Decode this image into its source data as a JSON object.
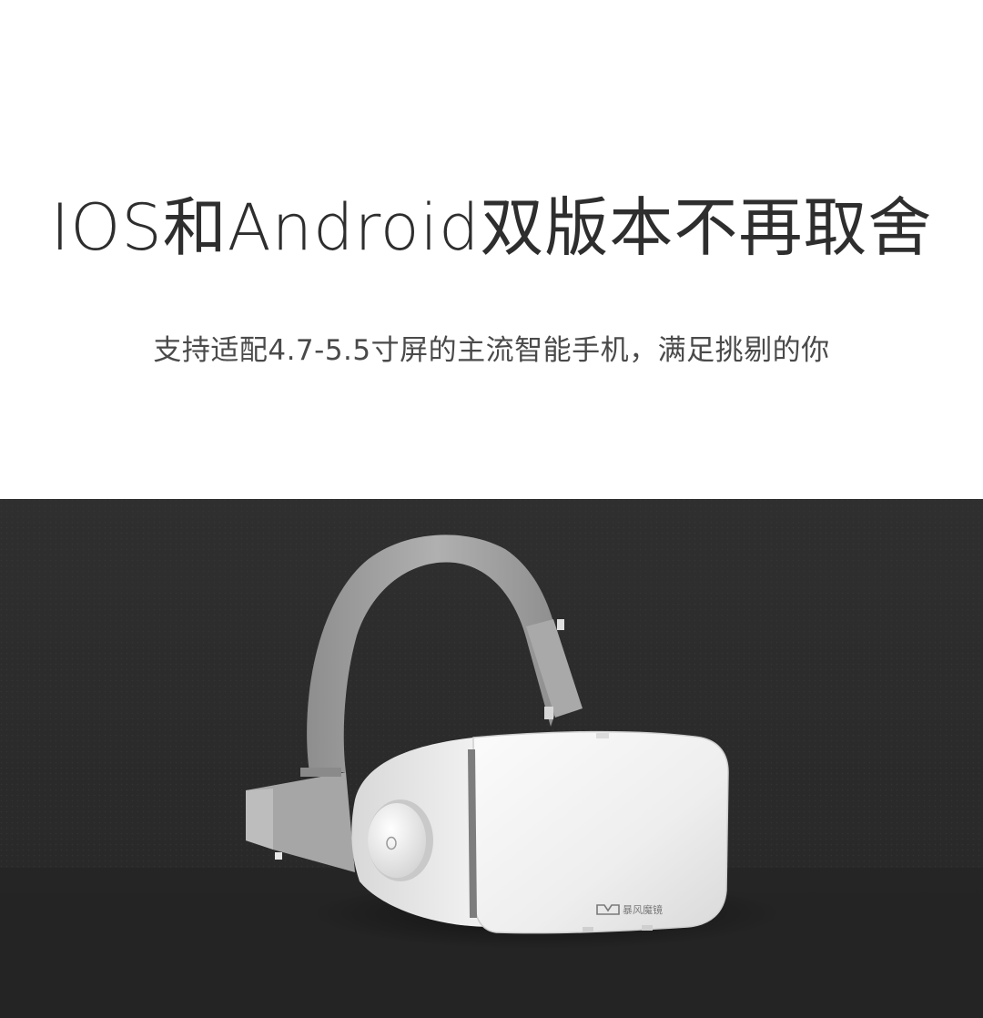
{
  "headline": "IOS和Android双版本不再取舍",
  "subline": "支持适配4.7-5.5寸屏的主流智能手机，满足挑剔的你",
  "product": {
    "brand_logo_text": "暴风魔镜",
    "colors": {
      "background_top": "#2f2f2f",
      "background_bottom": "#232323",
      "headset_body": "#f2f2f2",
      "strap": "#9a9a9a"
    }
  }
}
